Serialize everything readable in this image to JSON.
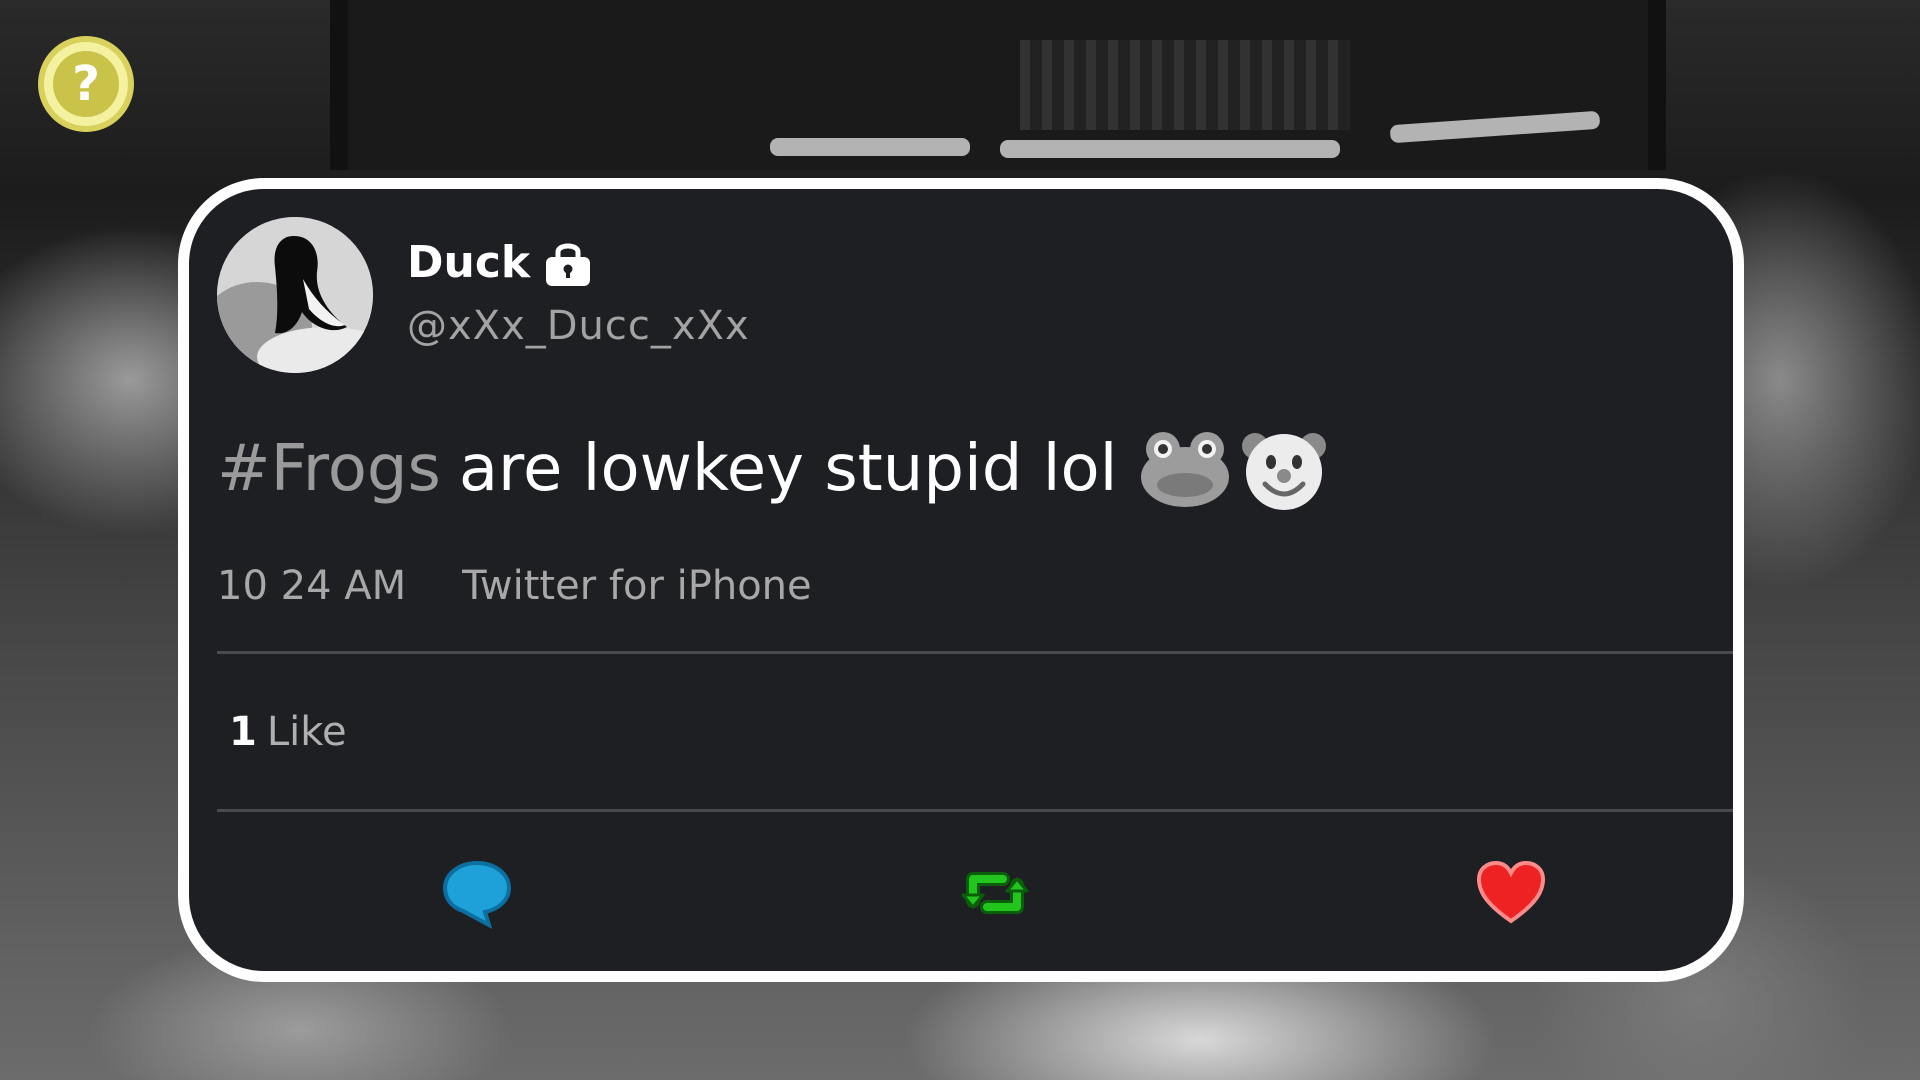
{
  "help_button": {
    "icon": "question-mark-icon",
    "glyph": "?"
  },
  "tweet": {
    "display_name": "Duck",
    "handle": "@xXx_Ducc_xXx",
    "hashtag": "#Frogs",
    "text": "are lowkey stupid lol",
    "time": "10 24 AM",
    "source": "Twitter for iPhone",
    "likes_count": "1",
    "likes_label": "Like"
  },
  "icons": {
    "lock": "lock-icon",
    "frog_emoji": "frog-emoji-icon",
    "clown_emoji": "clown-emoji-icon",
    "reply": "reply-icon",
    "retweet": "retweet-icon",
    "like": "heart-icon"
  },
  "colors": {
    "card_background": "#1e1f22",
    "card_border": "#ffffff",
    "reply": "#1da1d8",
    "retweet": "#22c41e",
    "like": "#ee2222",
    "help_button": "#f4f1a0"
  }
}
